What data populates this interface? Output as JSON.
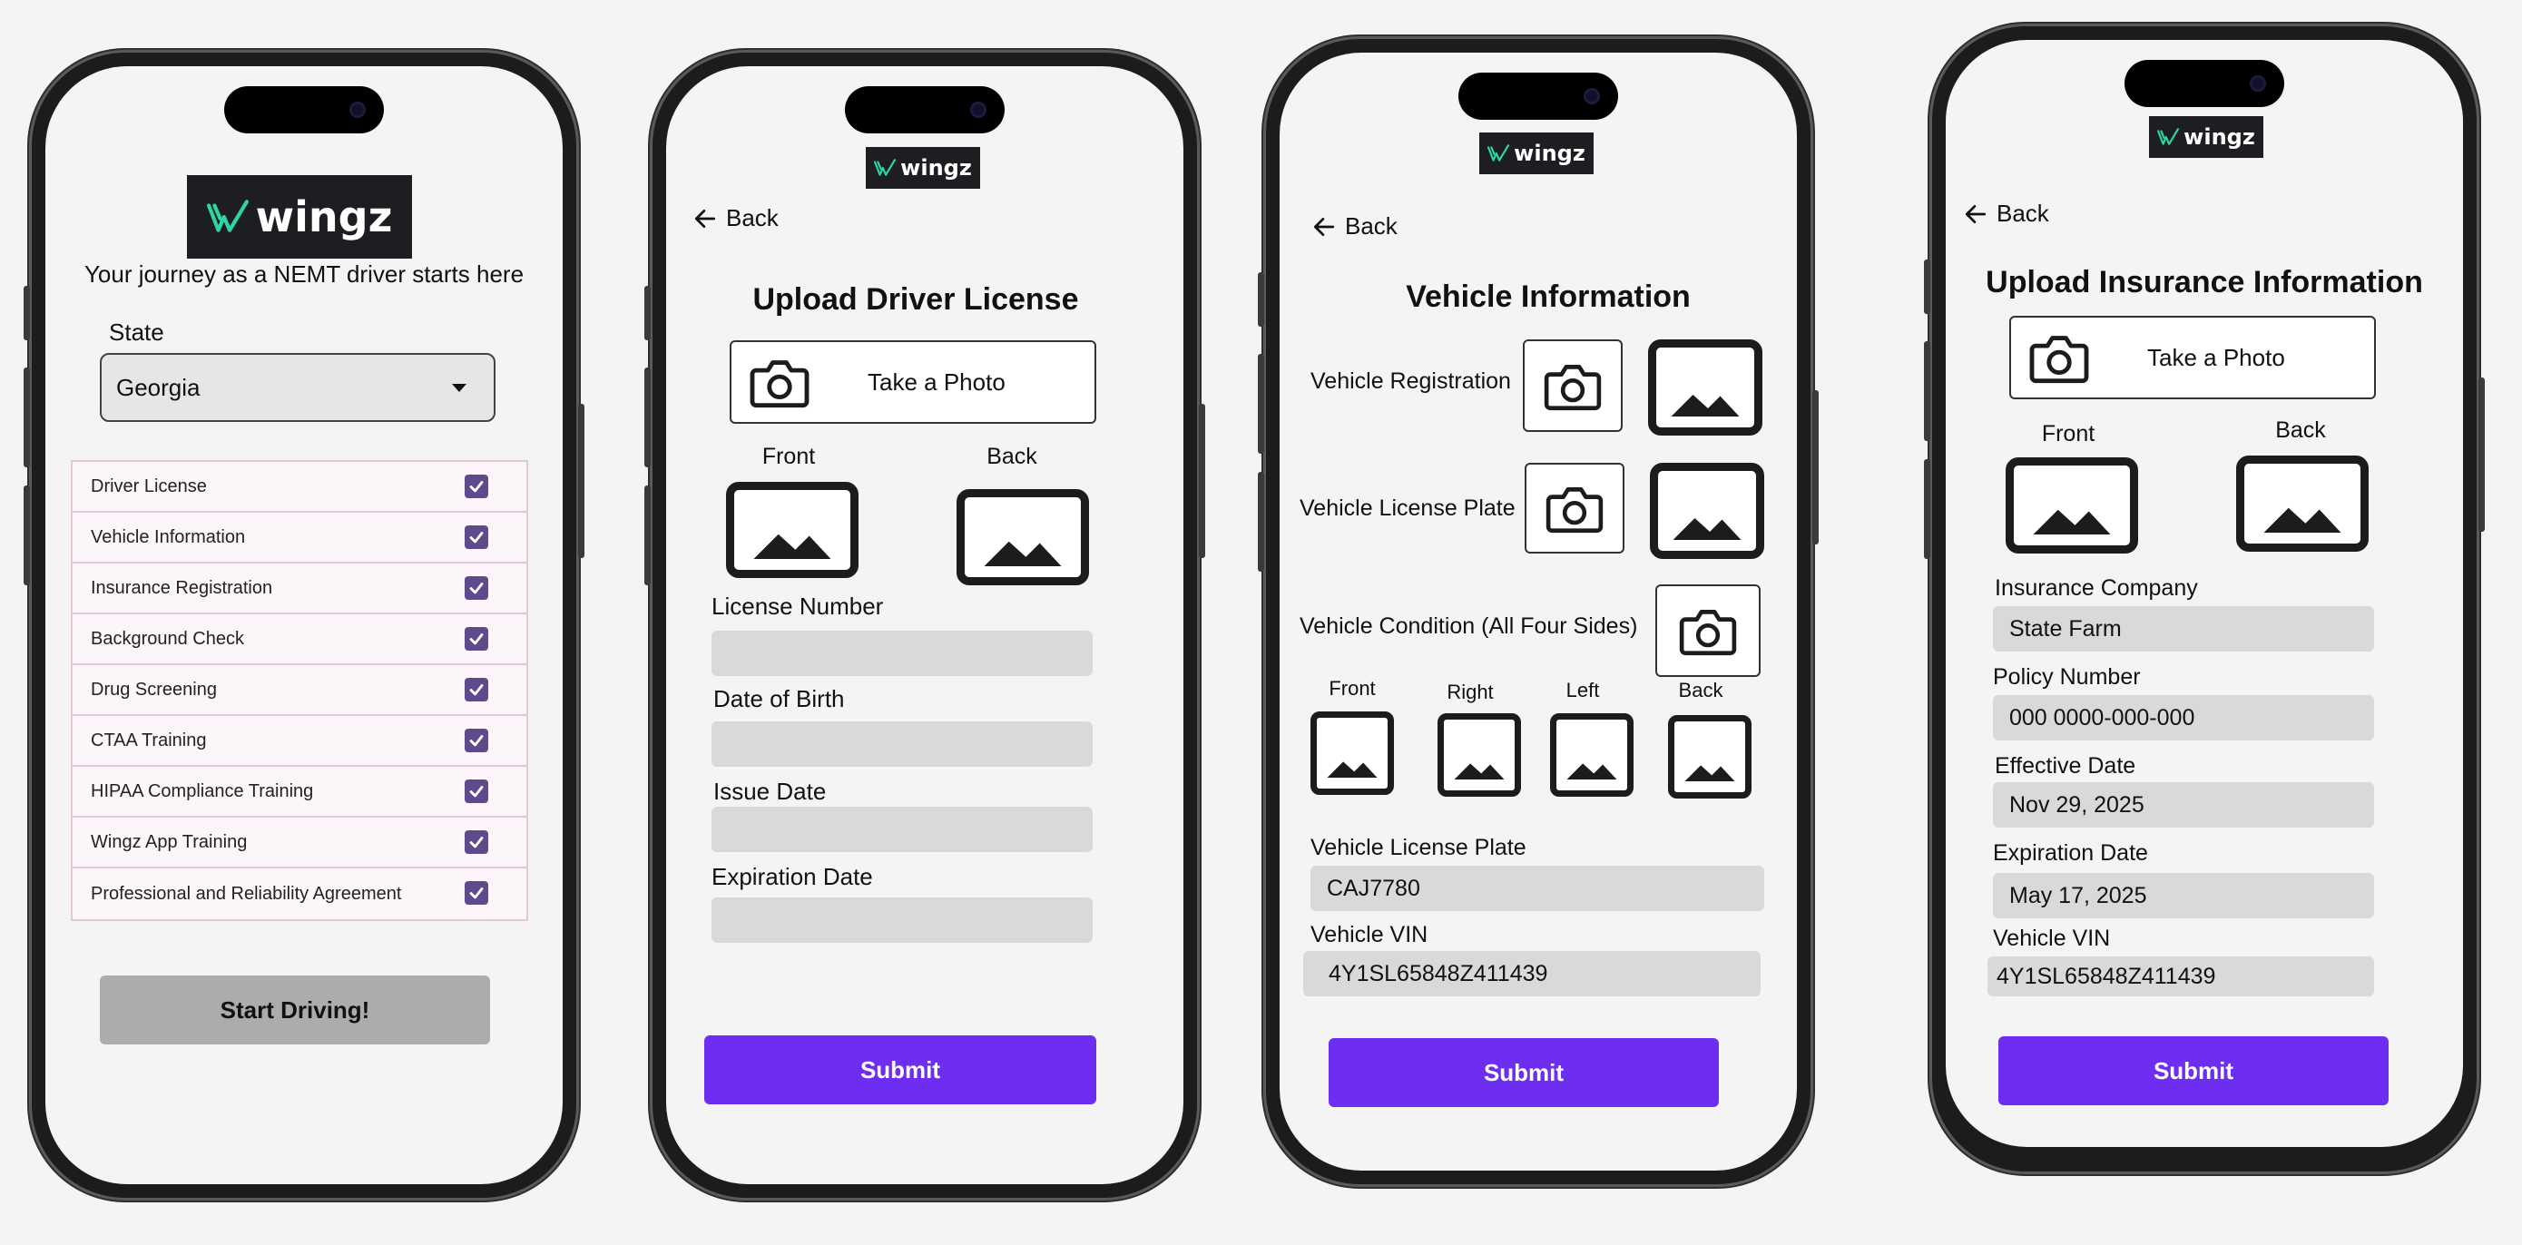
{
  "brand": {
    "logo_text": "wingz",
    "accent": "#2fd4a4",
    "primary": "#6e2ef2"
  },
  "screen1": {
    "tagline": "Your journey as a NEMT driver starts here",
    "state_label": "State",
    "state_value": "Georgia",
    "checklist": [
      "Driver License",
      "Vehicle Information",
      "Insurance Registration",
      "Background Check",
      "Drug Screening",
      "CTAA Training",
      "HIPAA Compliance Training",
      "Wingz App Training",
      "Professional and Reliability Agreement"
    ],
    "start_button": "Start Driving!"
  },
  "screen2": {
    "back": "Back",
    "title": "Upload Driver License",
    "take_photo": "Take a Photo",
    "front": "Front",
    "back_label": "Back",
    "fields": [
      {
        "label": "License Number",
        "value": ""
      },
      {
        "label": "Date of Birth",
        "value": ""
      },
      {
        "label": "Issue Date",
        "value": ""
      },
      {
        "label": "Expiration Date",
        "value": ""
      }
    ],
    "submit": "Submit"
  },
  "screen3": {
    "back": "Back",
    "title": "Vehicle Information",
    "registration": "Vehicle Registration",
    "license_plate": "Vehicle License Plate",
    "condition": "Vehicle Condition (All Four Sides)",
    "sides": [
      "Front",
      "Right",
      "Left",
      "Back"
    ],
    "fields": [
      {
        "label": "Vehicle License Plate",
        "value": "CAJ7780"
      },
      {
        "label": "Vehicle VIN",
        "value": "4Y1SL65848Z411439"
      }
    ],
    "submit": "Submit"
  },
  "screen4": {
    "back": "Back",
    "title": "Upload Insurance Information",
    "take_photo": "Take a Photo",
    "front": "Front",
    "back_label": "Back",
    "fields": [
      {
        "label": "Insurance Company",
        "value": "State Farm"
      },
      {
        "label": "Policy Number",
        "value": "000 0000-000-000"
      },
      {
        "label": "Effective Date",
        "value": "Nov 29, 2025"
      },
      {
        "label": "Expiration Date",
        "value": "May 17, 2025"
      },
      {
        "label": "Vehicle VIN",
        "value": "4Y1SL65848Z411439"
      }
    ],
    "submit": "Submit"
  }
}
